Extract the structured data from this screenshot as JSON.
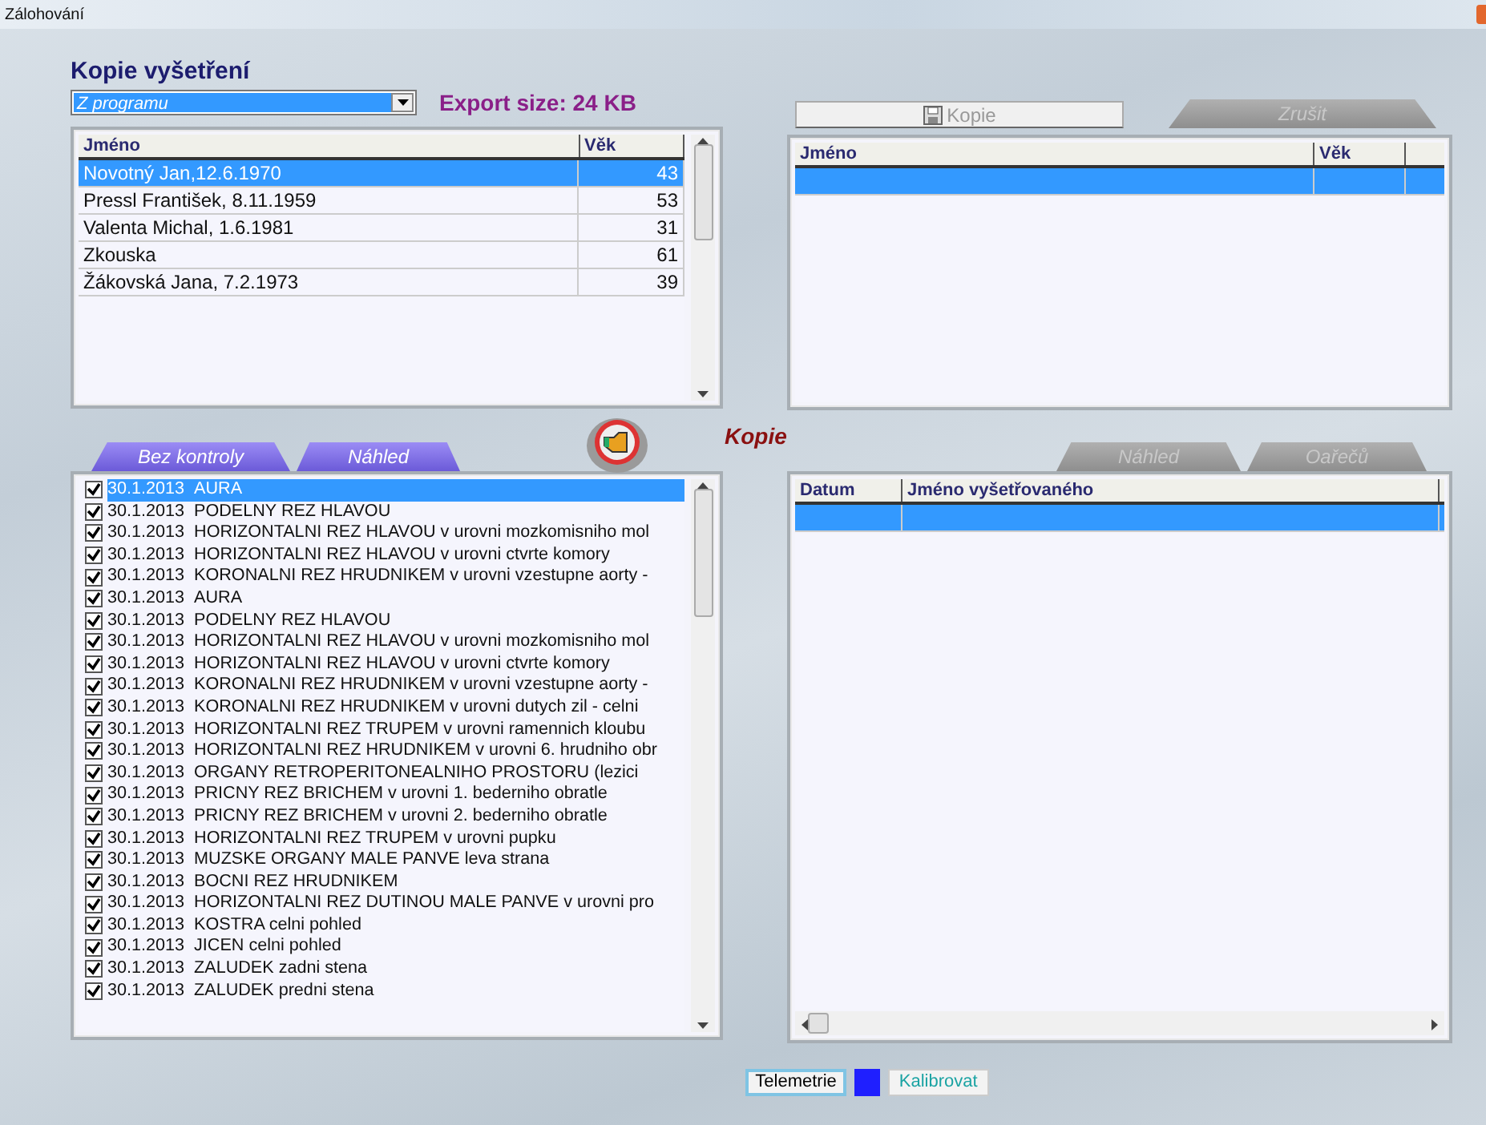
{
  "window": {
    "title": "Zálohování"
  },
  "heading": "Kopie vyšetření",
  "source_select": {
    "value": "Z programu"
  },
  "export_size": "Export size: 24 KB",
  "patients_table": {
    "columns": [
      "Jméno",
      "Věk"
    ],
    "rows": [
      {
        "cells": [
          "Novotný Jan,12.6.1970",
          "43"
        ],
        "selected": true
      },
      {
        "cells": [
          "Pressl František, 8.11.1959",
          "53"
        ],
        "selected": false
      },
      {
        "cells": [
          "Valenta Michal, 1.6.1981",
          "31"
        ],
        "selected": false
      },
      {
        "cells": [
          "Zkouska",
          "61"
        ],
        "selected": false
      },
      {
        "cells": [
          "Žákovská Jana, 7.2.1973",
          "39"
        ],
        "selected": false
      }
    ]
  },
  "copy_button": {
    "label": "Kopie",
    "disabled": true
  },
  "cancel_tab": {
    "label": "Zrušit",
    "disabled": true
  },
  "target_table": {
    "columns": [
      "Jméno",
      "Věk"
    ],
    "rows": [
      {
        "selected": true
      }
    ]
  },
  "transfer_label": "Kopie",
  "exam_tabs": [
    {
      "label": "Bez kontroly",
      "disabled": false
    },
    {
      "label": "Náhled",
      "disabled": false
    }
  ],
  "exams": [
    {
      "date": "30.1.2013",
      "title": "AURA",
      "checked": true,
      "selected": true
    },
    {
      "date": "30.1.2013",
      "title": "PODELNY REZ HLAVOU",
      "checked": true,
      "selected": false
    },
    {
      "date": "30.1.2013",
      "title": "HORIZONTALNI REZ HLAVOU v urovni mozkomisniho mol",
      "checked": true,
      "selected": false
    },
    {
      "date": "30.1.2013",
      "title": "HORIZONTALNI REZ HLAVOU v urovni ctvrte komory",
      "checked": true,
      "selected": false
    },
    {
      "date": "30.1.2013",
      "title": "KORONALNI REZ HRUDNIKEM v urovni vzestupne aorty -",
      "checked": true,
      "selected": false
    },
    {
      "date": "30.1.2013",
      "title": "AURA",
      "checked": true,
      "selected": false
    },
    {
      "date": "30.1.2013",
      "title": "PODELNY REZ HLAVOU",
      "checked": true,
      "selected": false
    },
    {
      "date": "30.1.2013",
      "title": "HORIZONTALNI REZ HLAVOU v urovni mozkomisniho mol",
      "checked": true,
      "selected": false
    },
    {
      "date": "30.1.2013",
      "title": "HORIZONTALNI REZ HLAVOU v urovni ctvrte komory",
      "checked": true,
      "selected": false
    },
    {
      "date": "30.1.2013",
      "title": "KORONALNI REZ HRUDNIKEM v urovni vzestupne aorty -",
      "checked": true,
      "selected": false
    },
    {
      "date": "30.1.2013",
      "title": "KORONALNI REZ HRUDNIKEM v urovni dutych zil - celni",
      "checked": true,
      "selected": false
    },
    {
      "date": "30.1.2013",
      "title": "HORIZONTALNI REZ TRUPEM v urovni ramennich kloubu",
      "checked": true,
      "selected": false
    },
    {
      "date": "30.1.2013",
      "title": "HORIZONTALNI REZ HRUDNIKEM v urovni 6. hrudniho obr",
      "checked": true,
      "selected": false
    },
    {
      "date": "30.1.2013",
      "title": "ORGANY RETROPERITONEALNIHO PROSTORU (lezici",
      "checked": true,
      "selected": false
    },
    {
      "date": "30.1.2013",
      "title": "PRICNY REZ BRICHEM v urovni 1. bederniho obratle",
      "checked": true,
      "selected": false
    },
    {
      "date": "30.1.2013",
      "title": "PRICNY REZ BRICHEM v urovni 2. bederniho obratle",
      "checked": true,
      "selected": false
    },
    {
      "date": "30.1.2013",
      "title": "HORIZONTALNI REZ TRUPEM v urovni pupku",
      "checked": true,
      "selected": false
    },
    {
      "date": "30.1.2013",
      "title": "MUZSKE ORGANY MALE PANVE leva strana",
      "checked": true,
      "selected": false
    },
    {
      "date": "30.1.2013",
      "title": "BOCNI REZ HRUDNIKEM",
      "checked": true,
      "selected": false
    },
    {
      "date": "30.1.2013",
      "title": "HORIZONTALNI REZ DUTINOU MALE PANVE v urovni pro",
      "checked": true,
      "selected": false
    },
    {
      "date": "30.1.2013",
      "title": "KOSTRA celni pohled",
      "checked": true,
      "selected": false
    },
    {
      "date": "30.1.2013",
      "title": "JICEN celni pohled",
      "checked": true,
      "selected": false
    },
    {
      "date": "30.1.2013",
      "title": "ZALUDEK zadni stena",
      "checked": true,
      "selected": false
    },
    {
      "date": "30.1.2013",
      "title": "ZALUDEK predni stena",
      "checked": true,
      "selected": false
    }
  ],
  "result_tabs": [
    {
      "label": "Náhled",
      "disabled": true
    },
    {
      "label": "Oařečů",
      "disabled": true
    }
  ],
  "result_table": {
    "columns": [
      "Datum",
      "Jméno vyšetřovaného"
    ],
    "rows": [
      {
        "selected": true
      }
    ]
  },
  "footer": [
    {
      "kind": "button",
      "label": "Telemetrie"
    },
    {
      "kind": "swatch",
      "color": "#1f1fff"
    },
    {
      "kind": "link",
      "label": "Kalibrovat"
    }
  ]
}
